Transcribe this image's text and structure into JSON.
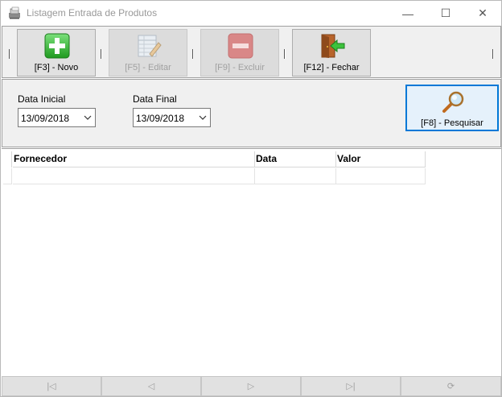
{
  "window": {
    "title": "Listagem Entrada de Produtos",
    "controls": {
      "minimize": "—",
      "maximize": "☐",
      "close": "✕"
    }
  },
  "toolbar": {
    "separator": "|",
    "buttons": [
      {
        "label": "[F3] - Novo",
        "icon": "plus-icon",
        "enabled": true,
        "color": "#2db52d"
      },
      {
        "label": "[F5] - Editar",
        "icon": "edit-sheet-icon",
        "enabled": false
      },
      {
        "label": "[F9] - Excluir",
        "icon": "minus-icon",
        "enabled": false,
        "color": "#d97b7b"
      },
      {
        "label": "[F12] - Fechar",
        "icon": "exit-door-icon",
        "enabled": true
      }
    ]
  },
  "filter": {
    "start_label": "Data Inicial",
    "start_value": "13/09/2018",
    "end_label": "Data Final",
    "end_value": "13/09/2018",
    "search_label": "[F8] - Pesquisar",
    "search_icon": "magnifier-icon"
  },
  "grid": {
    "columns": [
      "Fornecedor",
      "Data",
      "Valor"
    ],
    "rows": []
  },
  "navigator": {
    "buttons": [
      {
        "name": "first",
        "glyph": "|◁"
      },
      {
        "name": "prior",
        "glyph": "◁"
      },
      {
        "name": "next",
        "glyph": "▷"
      },
      {
        "name": "last",
        "glyph": "▷|"
      },
      {
        "name": "refresh",
        "glyph": "⟳"
      }
    ]
  },
  "colors": {
    "accent": "#0078d7",
    "disabled_text": "#a0a0a0"
  }
}
